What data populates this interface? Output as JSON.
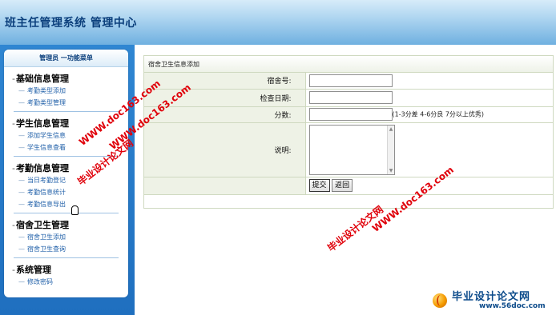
{
  "header": {
    "title": "班主任管理系统  管理中心"
  },
  "sidebar": {
    "title": "管理员  一功能菜单",
    "groups": [
      {
        "title": "基础信息管理",
        "items": [
          "考勤类型添加",
          "考勤类型管理"
        ]
      },
      {
        "title": "学生信息管理",
        "items": [
          "添加学生信息",
          "学生信息查看"
        ]
      },
      {
        "title": "考勤信息管理",
        "items": [
          "当日考勤登记",
          "考勤信息统计",
          "考勤信息导出"
        ]
      },
      {
        "title": "宿舍卫生管理",
        "items": [
          "宿舍卫生添加",
          "宿舍卫生查询"
        ]
      },
      {
        "title": "系统管理",
        "items": [
          "修改密码"
        ]
      }
    ]
  },
  "form": {
    "heading": "宿舍卫生信息添加",
    "fields": {
      "dorm_no": {
        "label": "宿舍号:",
        "value": ""
      },
      "check_date": {
        "label": "检查日期:",
        "value": ""
      },
      "score": {
        "label": "分数:",
        "value": "",
        "hint": "(1-3分差  4-6分良  7分以上优秀)"
      },
      "remark": {
        "label": "说明:",
        "value": ""
      }
    },
    "submit_label": "提交",
    "back_label": "返回"
  },
  "watermarks": {
    "site": "WWW.doc163.com",
    "text": "毕业设计论文网"
  },
  "logo": {
    "name": "毕业设计论文网",
    "url": "www.56doc.com"
  }
}
